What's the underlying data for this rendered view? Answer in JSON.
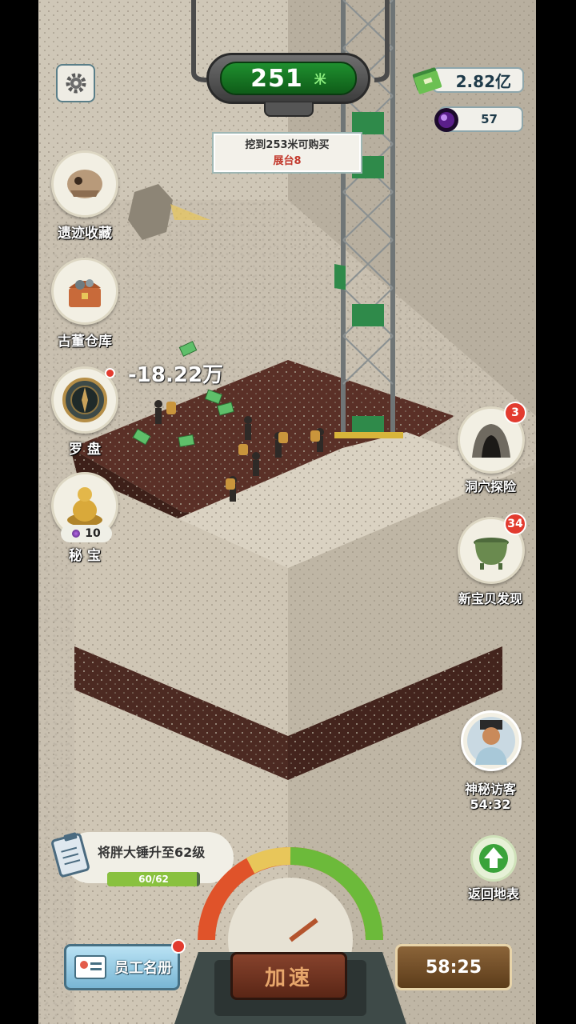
{
  "hud": {
    "depth_value": "251",
    "depth_unit": "米",
    "target_line1": "挖到253米可购买",
    "target_line2": "展台8",
    "money": "2.82亿",
    "gems": "57",
    "money_gain": "-18.22万"
  },
  "left_menu": {
    "relics": "遗迹收藏",
    "warehouse": "古董仓库",
    "compass": "罗 盘",
    "secret": "秘 宝",
    "secret_gem_count": "10"
  },
  "right_menu": {
    "cave": "洞穴探险",
    "cave_badge": "3",
    "treasure": "新宝贝发现",
    "treasure_badge": "34",
    "visitor": "神秘访客",
    "visitor_timer": "54:32",
    "return": "返回地表"
  },
  "task": {
    "label": "将胖大锤升至62级",
    "progress_text": "60/62",
    "progress_fraction": 0.968
  },
  "bottom": {
    "staff": "员工名册",
    "speed": "加速",
    "timer": "58:25"
  },
  "colors": {
    "depth_screen": "#1f8f2f",
    "soil": "#4c2a22",
    "rock": "#c9c0b0",
    "alert": "#e23b2f"
  }
}
